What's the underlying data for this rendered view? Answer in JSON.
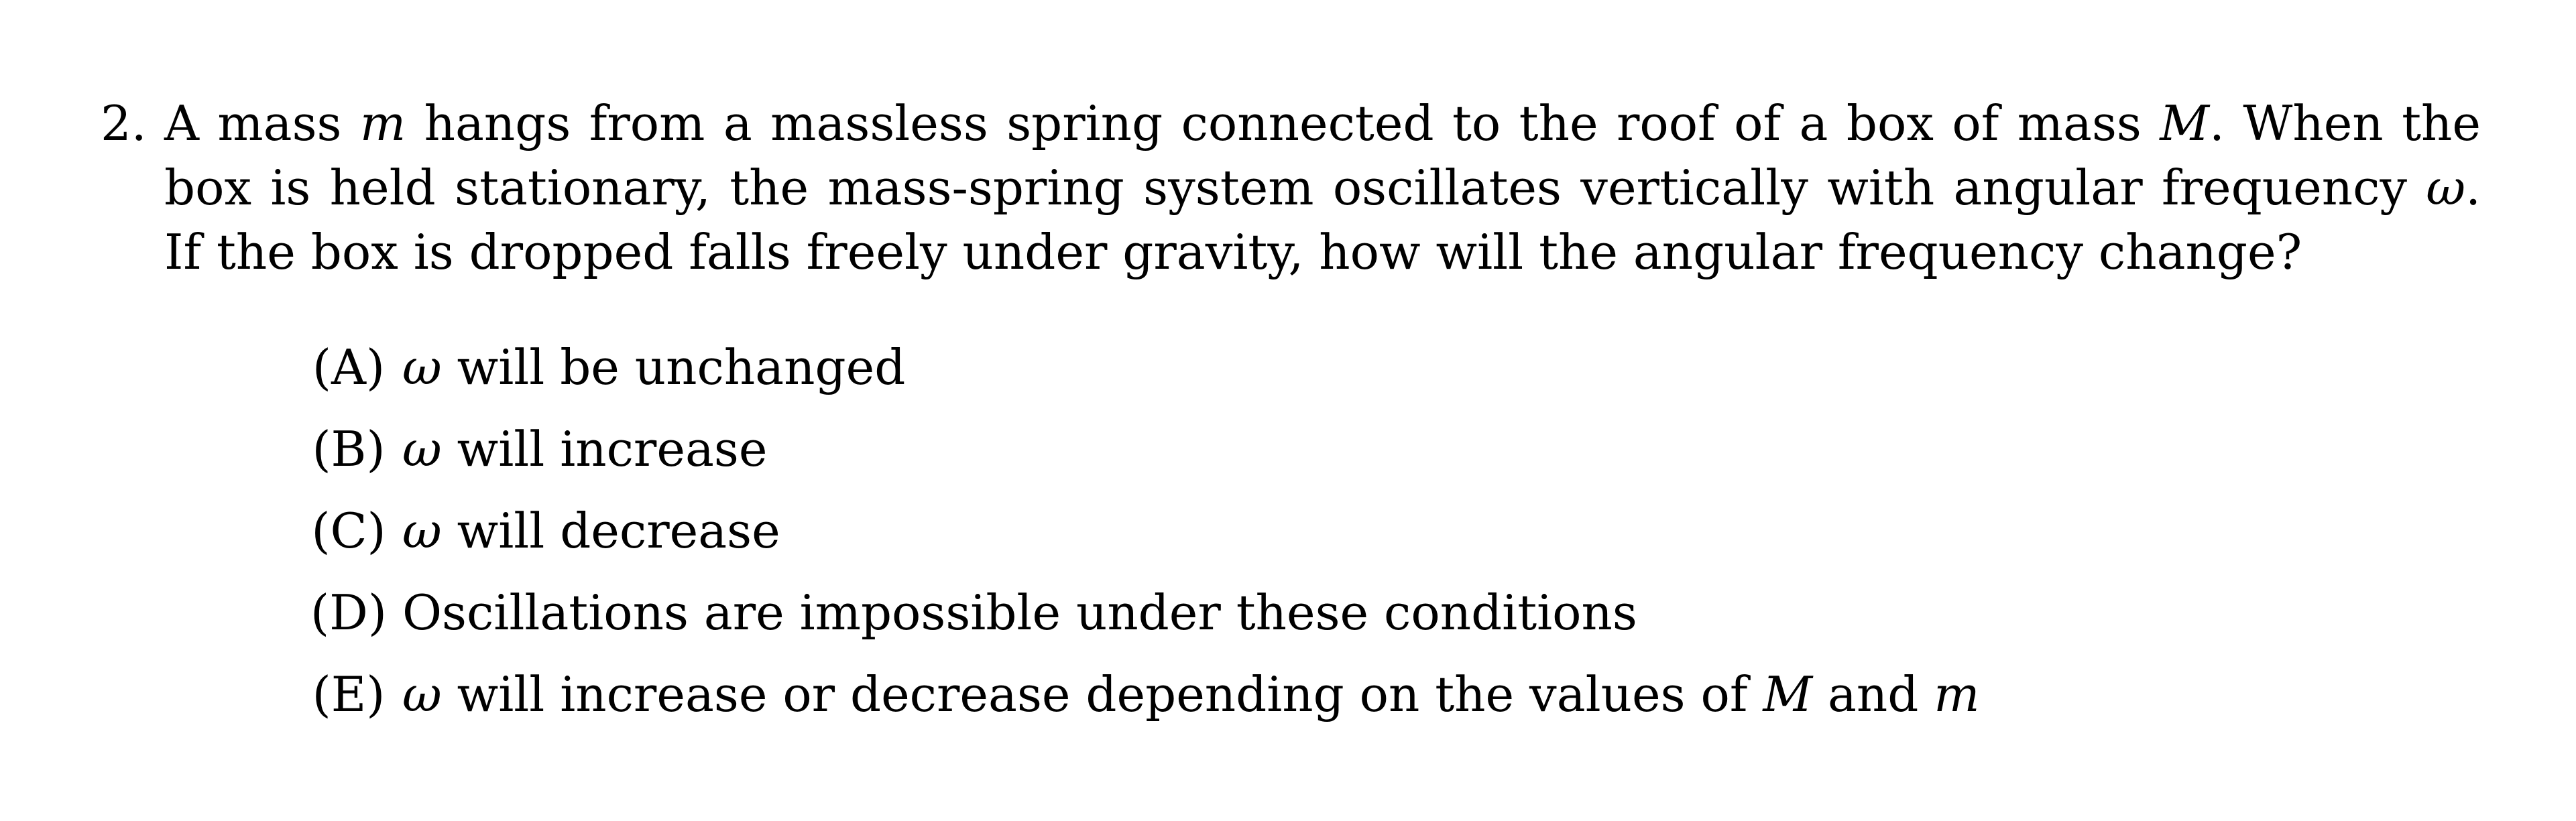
{
  "problem": {
    "number": "2.",
    "q1": "A mass ",
    "m_var": "m",
    "q2": " hangs from a massless spring connected to the roof of a box of mass ",
    "M_var": "M",
    "q3": ". When the box is held stationary, the mass-spring system oscillates vertically with angular frequency ",
    "omega_var": "ω",
    "q4": ". If the box is dropped falls freely under gravity, how will the angular frequency change?"
  },
  "choices": [
    {
      "label": "(A)",
      "omega": "ω",
      "text": " will be unchanged"
    },
    {
      "label": "(B)",
      "omega": "ω",
      "text": " will increase"
    },
    {
      "label": "(C)",
      "omega": "ω",
      "text": " will decrease"
    },
    {
      "label": "(D)",
      "text": "Oscillations are impossible under these conditions"
    },
    {
      "label": "(E)",
      "omega": "ω",
      "text_a": " will increase or decrease depending on the values of ",
      "M_var": "M",
      "text_b": " and ",
      "m_var": "m"
    }
  ]
}
